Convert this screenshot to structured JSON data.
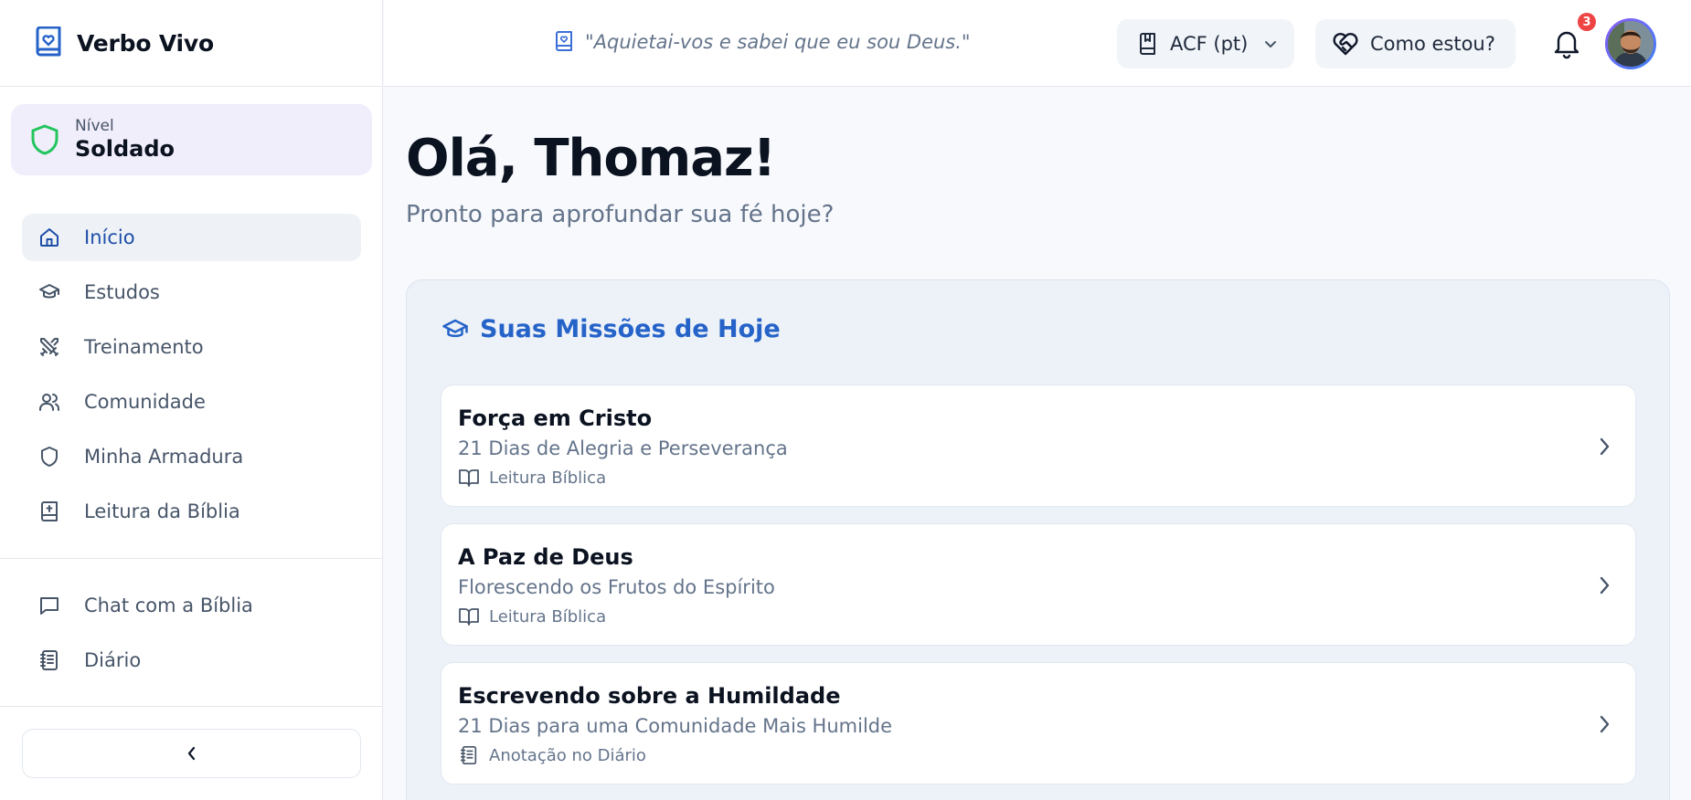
{
  "app": {
    "name": "Verbo Vivo"
  },
  "header": {
    "verse": "\"Aquietai-vos e sabei que eu sou Deus.\"",
    "version_label": "ACF (pt)",
    "mood_label": "Como estou?",
    "notifications_count": "3"
  },
  "sidebar": {
    "level": {
      "label": "Nível",
      "value": "Soldado"
    },
    "items": [
      {
        "label": "Início",
        "icon": "home-icon",
        "active": true
      },
      {
        "label": "Estudos",
        "icon": "graduation-cap-icon"
      },
      {
        "label": "Treinamento",
        "icon": "crossed-swords-icon"
      },
      {
        "label": "Comunidade",
        "icon": "users-icon"
      },
      {
        "label": "Minha Armadura",
        "icon": "shield-icon"
      },
      {
        "label": "Leitura da Bíblia",
        "icon": "bible-icon"
      }
    ],
    "secondary_items": [
      {
        "label": "Chat com a Bíblia",
        "icon": "chat-icon"
      },
      {
        "label": "Diário",
        "icon": "notebook-icon"
      }
    ],
    "collapse_icon": "chevron-left-icon"
  },
  "main": {
    "greeting": "Olá, Thomaz!",
    "subtitle": "Pronto para aprofundar sua fé hoje?",
    "missions": {
      "title": "Suas Missões de Hoje",
      "items": [
        {
          "title": "Força em Cristo",
          "description": "21 Dias de Alegria e Perseverança",
          "tag": "Leitura Bíblica",
          "tag_icon": "open-book-icon"
        },
        {
          "title": "A Paz de Deus",
          "description": "Florescendo os Frutos do Espírito",
          "tag": "Leitura Bíblica",
          "tag_icon": "open-book-icon"
        },
        {
          "title": "Escrevendo sobre a Humildade",
          "description": "21 Dias para uma Comunidade Mais Humilde",
          "tag": "Anotação no Diário",
          "tag_icon": "notebook-icon"
        }
      ]
    }
  },
  "colors": {
    "accent": "#2563c9",
    "active_nav": "#1e4fa8",
    "level_bg": "#f1eefc",
    "shield_green": "#22c55e",
    "badge_red": "#ef4444"
  }
}
